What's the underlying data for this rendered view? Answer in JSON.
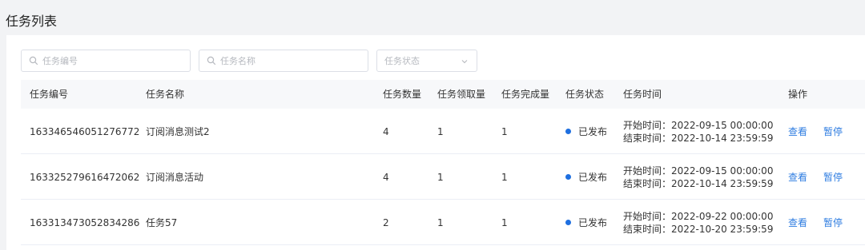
{
  "page": {
    "title": "任务列表"
  },
  "filters": {
    "task_id_placeholder": "任务编号",
    "task_name_placeholder": "任务名称",
    "status_placeholder": "任务状态"
  },
  "table": {
    "headers": {
      "id": "任务编号",
      "name": "任务名称",
      "count": "任务数量",
      "claimed": "任务领取量",
      "completed": "任务完成量",
      "status": "任务状态",
      "time": "任务时间",
      "actions": "操作"
    },
    "rows": [
      {
        "id": "163346546051276772",
        "name": "订阅消息测试2",
        "count": "4",
        "claimed": "1",
        "completed": "1",
        "status": "已发布",
        "start": "开始时间：2022-09-15 00:00:00",
        "end": "结束时间：2022-10-14 23:59:59",
        "view": "查看",
        "pause": "暂停"
      },
      {
        "id": "163325279616472062",
        "name": "订阅消息活动",
        "count": "4",
        "claimed": "1",
        "completed": "1",
        "status": "已发布",
        "start": "开始时间：2022-09-15 00:00:00",
        "end": "结束时间：2022-10-14 23:59:59",
        "view": "查看",
        "pause": "暂停"
      },
      {
        "id": "163313473052834286",
        "name": "任务57",
        "count": "2",
        "claimed": "1",
        "completed": "1",
        "status": "已发布",
        "start": "开始时间：2022-09-22 00:00:00",
        "end": "结束时间：2022-10-20 23:59:59",
        "view": "查看",
        "pause": "暂停"
      }
    ]
  },
  "colors": {
    "accent": "#2f7de1",
    "status_dot": "#1e6fe0",
    "header_bg": "#f7f8fa"
  },
  "icons": {
    "search": "search-icon",
    "dropdown": "chevron-down-icon"
  }
}
